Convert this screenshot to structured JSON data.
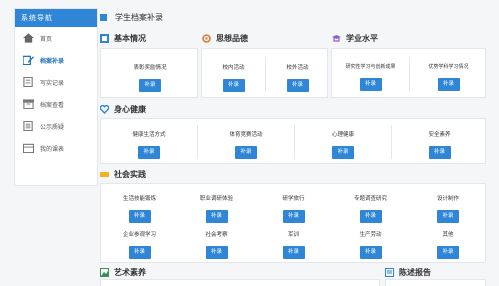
{
  "sidebar": {
    "title": "系统导航",
    "items": [
      {
        "label": "首页",
        "active": false
      },
      {
        "label": "档案补录",
        "active": true
      },
      {
        "label": "写实记录",
        "active": false
      },
      {
        "label": "档案查看",
        "active": false
      },
      {
        "label": "公示质疑",
        "active": false
      },
      {
        "label": "我的课表",
        "active": false
      }
    ]
  },
  "page": {
    "title": "学生档案补录"
  },
  "sections": {
    "basic": {
      "title": "基本情况",
      "items": [
        {
          "label": "表彰奖励情况",
          "button": "补录"
        }
      ]
    },
    "moral": {
      "title": "思想品德",
      "items": [
        {
          "label": "校内活动",
          "button": "补录"
        },
        {
          "label": "校外活动",
          "button": "补录"
        }
      ]
    },
    "academic": {
      "title": "学业水平",
      "items": [
        {
          "label": "研究性学习与创新成果",
          "button": "补录"
        },
        {
          "label": "优势学科学习情况",
          "button": "补录"
        }
      ]
    },
    "health": {
      "title": "身心健康",
      "items": [
        {
          "label": "健康生活方式",
          "button": "补录"
        },
        {
          "label": "体育竞赛活动",
          "button": "补录"
        },
        {
          "label": "心理健康",
          "button": "补录"
        },
        {
          "label": "安全素养",
          "button": "补录"
        }
      ]
    },
    "social": {
      "title": "社会实践",
      "items": [
        {
          "label": "生活技能锻炼",
          "button": "补录"
        },
        {
          "label": "职业调研体验",
          "button": "补录"
        },
        {
          "label": "研学旅行",
          "button": "补录"
        },
        {
          "label": "专题调查研究",
          "button": "补录"
        },
        {
          "label": "设计制作",
          "button": "补录"
        },
        {
          "label": "企业参观学习",
          "button": "补录"
        },
        {
          "label": "社会考察",
          "button": "补录"
        },
        {
          "label": "军训",
          "button": "补录"
        },
        {
          "label": "生产劳动",
          "button": "补录"
        },
        {
          "label": "其他",
          "button": "补录"
        }
      ]
    },
    "art": {
      "title": "艺术素养"
    },
    "statement": {
      "title": "陈述报告"
    }
  },
  "colors": {
    "accent": "#2f86d6",
    "moral_icon": "#e8743b",
    "academic_icon": "#8a5fd0",
    "health_icon": "#2f86d6",
    "social_icon": "#f0b323",
    "art_icon": "#3a8f5a"
  }
}
